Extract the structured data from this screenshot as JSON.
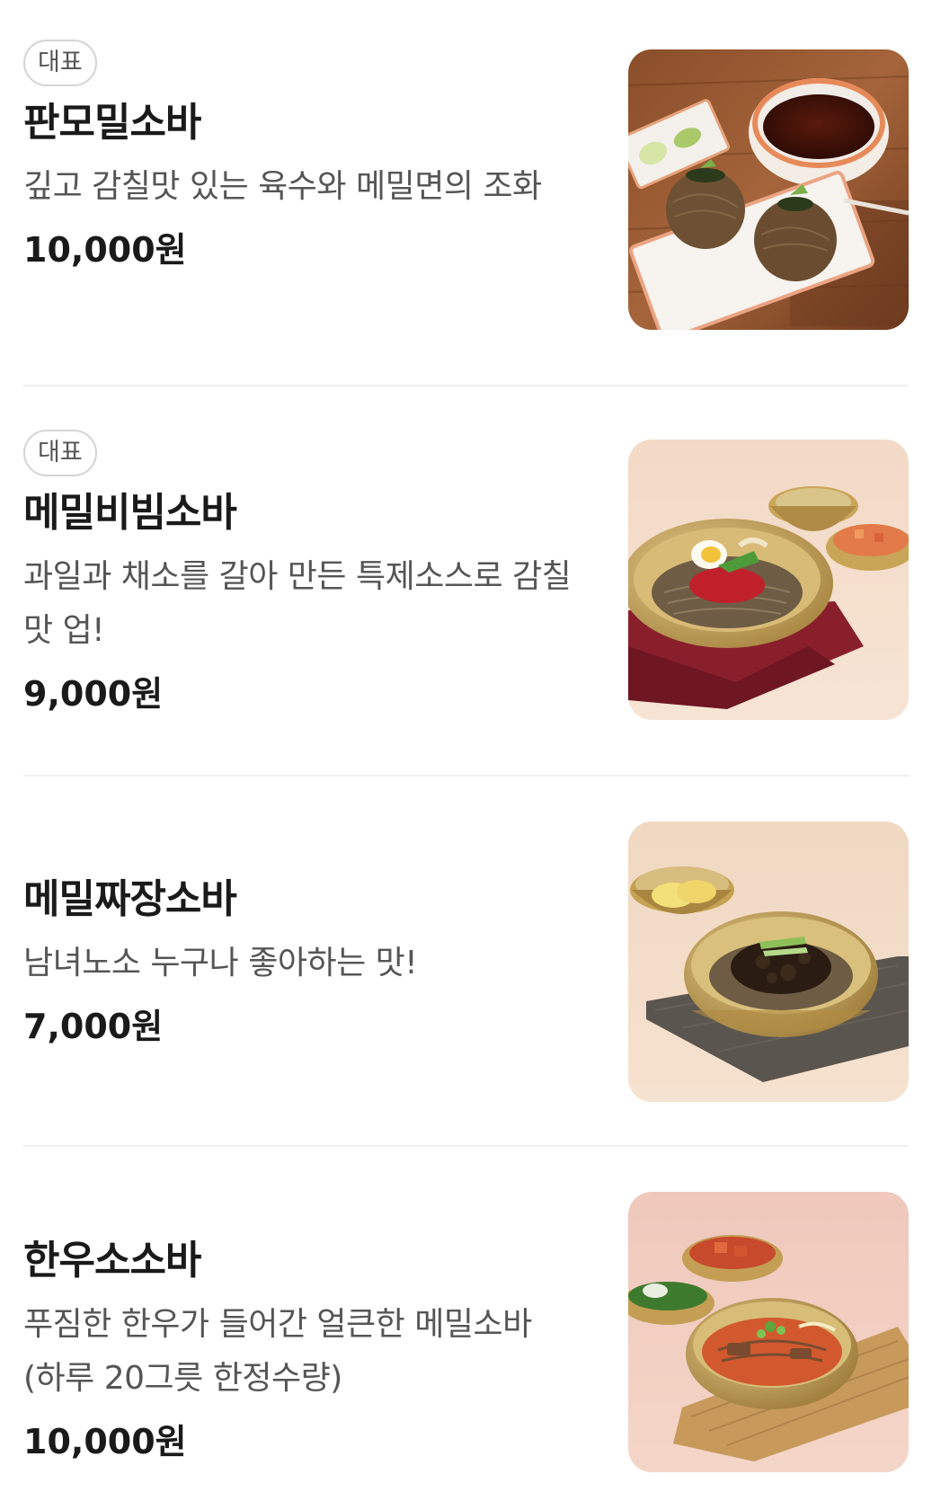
{
  "menu": {
    "items": [
      {
        "badge": "대표",
        "name": "판모밀소바",
        "description": "깊고 감칠맛 있는 육수와 메밀면의 조화",
        "price": "10,000원",
        "image_icon": "zaru-soba-photo"
      },
      {
        "badge": "대표",
        "name": "메밀비빔소바",
        "description": "과일과 채소를 갈아 만든 특제소스로 감칠맛 업!",
        "price": "9,000원",
        "image_icon": "bibim-soba-photo"
      },
      {
        "name": "메밀짜장소바",
        "description": "남녀노소 누구나 좋아하는 맛!",
        "price": "7,000원",
        "image_icon": "jjajang-soba-photo"
      },
      {
        "name": "한우소소바",
        "description": "푸짐한 한우가 들어간 얼큰한 메밀소바 (하루 20그릇 한정수량)",
        "price": "10,000원",
        "image_icon": "hanwoo-soba-photo"
      }
    ]
  },
  "colors": {
    "text_primary": "#1a1a1a",
    "text_secondary": "#555555",
    "divider": "#eeeeee",
    "badge_border": "#d4d4d4"
  }
}
